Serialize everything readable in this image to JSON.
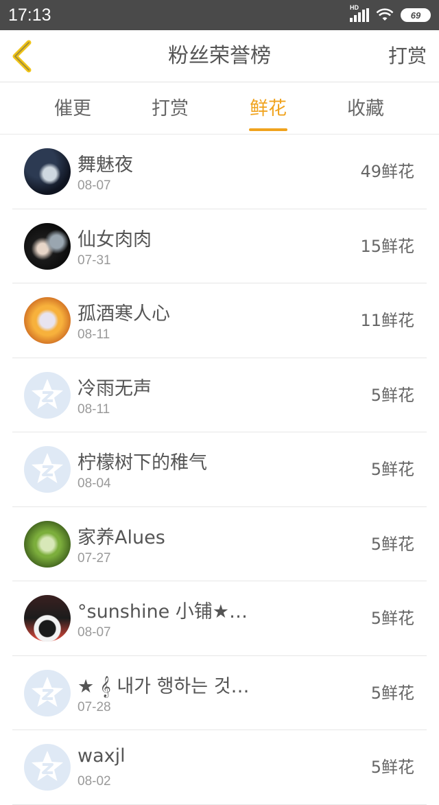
{
  "status_bar": {
    "time": "17:13",
    "network": "HD",
    "battery": "69"
  },
  "header": {
    "title": "粉丝荣誉榜",
    "right_action": "打赏"
  },
  "tabs": [
    {
      "label": "催更",
      "active": false
    },
    {
      "label": "打赏",
      "active": false
    },
    {
      "label": "鲜花",
      "active": true
    },
    {
      "label": "收藏",
      "active": false
    }
  ],
  "colors": {
    "accent": "#f0a31e",
    "status_bar": "#4a4a4a",
    "default_avatar": "#dfe9f5"
  },
  "fans": [
    {
      "name": "舞魅夜",
      "date": "08-07",
      "count": "49鲜花",
      "avatar": "dark-anime"
    },
    {
      "name": "仙女肉肉",
      "date": "07-31",
      "count": "15鲜花",
      "avatar": "dark-portrait"
    },
    {
      "name": "孤酒寒人心",
      "date": "08-11",
      "count": "11鲜花",
      "avatar": "autumn-anime"
    },
    {
      "name": "冷雨无声",
      "date": "08-11",
      "count": "5鲜花",
      "avatar": "default-qq-icon"
    },
    {
      "name": "柠檬树下的稚气",
      "date": "08-04",
      "count": "5鲜花",
      "avatar": "default-qq-icon"
    },
    {
      "name": "家养Alues",
      "date": "07-27",
      "count": "5鲜花",
      "avatar": "green-portrait"
    },
    {
      "name": "°sunshine 小铺★…",
      "date": "08-07",
      "count": "5鲜花",
      "avatar": "hoodie-photo"
    },
    {
      "name": "★ 𝄞 내가 행하는 것…",
      "date": "07-28",
      "count": "5鲜花",
      "avatar": "default-qq-icon"
    },
    {
      "name": "waxjl",
      "date": "08-02",
      "count": "5鲜花",
      "avatar": "default-qq-icon"
    }
  ]
}
